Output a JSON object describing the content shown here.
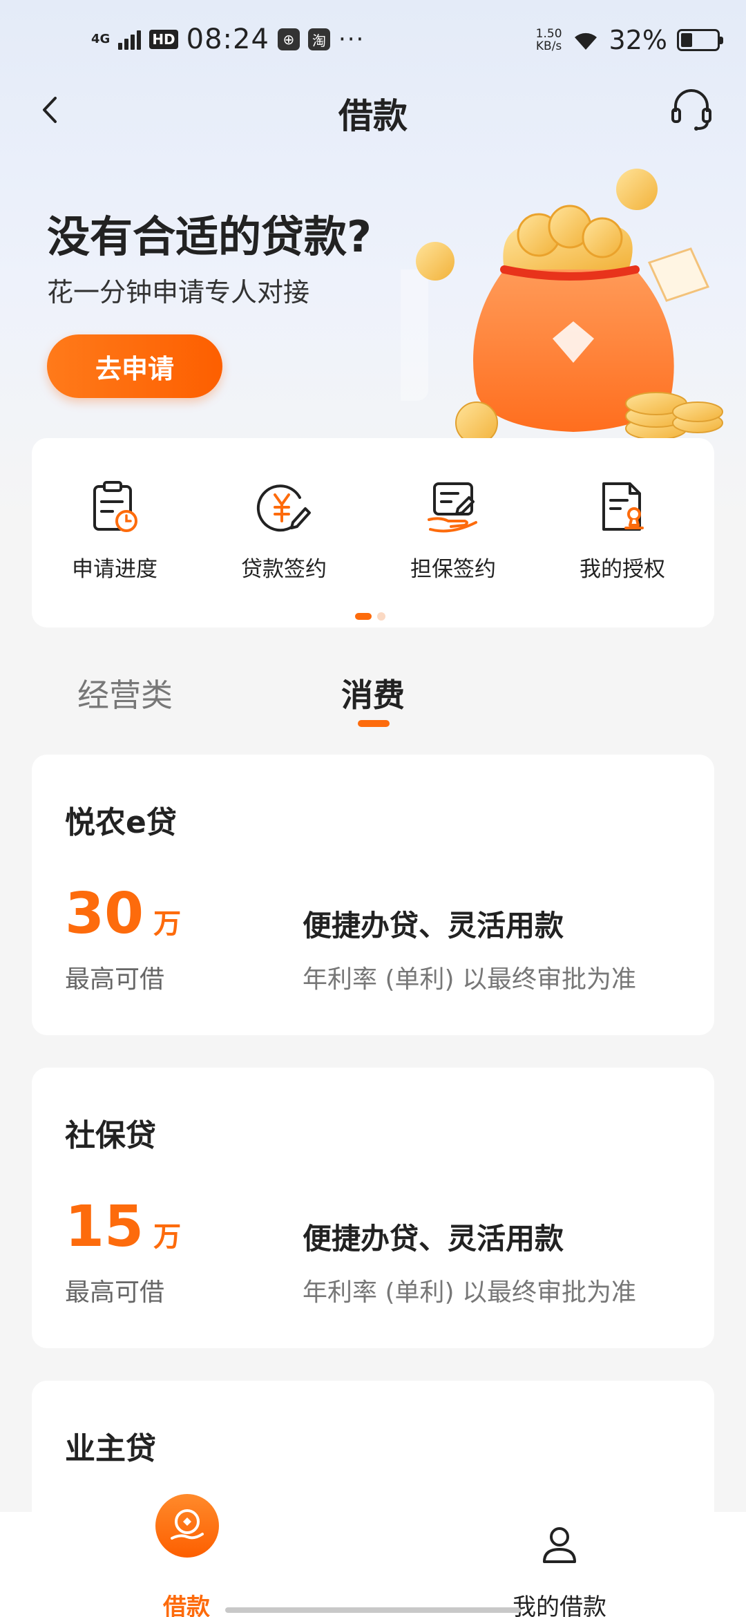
{
  "status_bar": {
    "network": "4G",
    "hd": "HD",
    "time": "08:24",
    "app1": "⊕",
    "app2": "淘",
    "more": "···",
    "speed_value": "1.50",
    "speed_unit": "KB/s",
    "battery_percent": "32%",
    "battery_level": 0.32
  },
  "header": {
    "title": "借款",
    "back_icon": "chevron-left-icon",
    "support_icon": "headset-icon"
  },
  "banner": {
    "title": "没有合适的贷款?",
    "subtitle": "花一分钟申请专人对接",
    "button_label": "去申请"
  },
  "quick_menu": {
    "items": [
      {
        "label": "申请进度",
        "icon": "clipboard-clock-icon"
      },
      {
        "label": "贷款签约",
        "icon": "yuan-sign-icon"
      },
      {
        "label": "担保签约",
        "icon": "hand-document-icon"
      },
      {
        "label": "我的授权",
        "icon": "document-stamp-icon"
      }
    ],
    "page_current": 1,
    "page_count": 2
  },
  "tabs": [
    {
      "label": "经营类",
      "active": false
    },
    {
      "label": "消费",
      "active": true
    }
  ],
  "products": [
    {
      "name": "悦农e贷",
      "amount": "30",
      "unit": "万",
      "amount_caption": "最高可借",
      "slogan": "便捷办贷、灵活用款",
      "rate_note": "年利率 (单利) 以最终审批为准"
    },
    {
      "name": "社保贷",
      "amount": "15",
      "unit": "万",
      "amount_caption": "最高可借",
      "slogan": "便捷办贷、灵活用款",
      "rate_note": "年利率 (单利) 以最终审批为准"
    },
    {
      "name": "业主贷"
    }
  ],
  "bottom_nav": {
    "items": [
      {
        "label": "借款",
        "icon": "loan-icon",
        "active": true
      },
      {
        "label": "我的借款",
        "icon": "user-icon",
        "active": false
      }
    ]
  },
  "colors": {
    "accent": "#fd6b0c",
    "background": "#f5f5f5",
    "hero_background": "#e4ebf8"
  }
}
